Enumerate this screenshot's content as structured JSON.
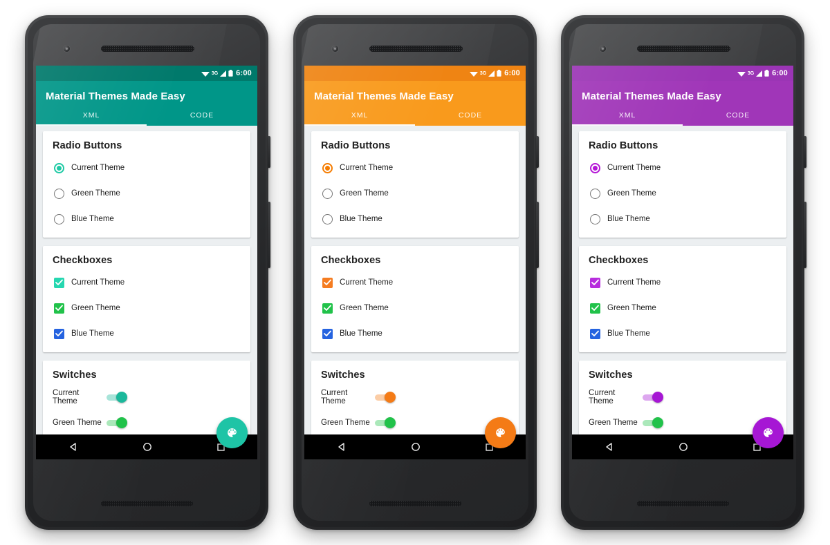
{
  "app": {
    "title": "Material Themes Made Easy",
    "tabs": [
      {
        "label": "XML",
        "selected": true
      },
      {
        "label": "CODE",
        "selected": false
      }
    ],
    "statusbar": {
      "time": "6:00",
      "network": "3G",
      "wifi_icon": "wifi-icon",
      "signal_icon": "signal-icon",
      "battery_icon": "battery-icon"
    },
    "fab": {
      "icon": "palette-icon"
    },
    "navbar": {
      "back": "back-triangle-icon",
      "home": "home-circle-icon",
      "recents": "recents-square-icon"
    }
  },
  "cards": {
    "radio": {
      "title": "Radio Buttons",
      "options": [
        "Current Theme",
        "Green Theme",
        "Blue Theme"
      ],
      "selected_index": 0
    },
    "checkbox": {
      "title": "Checkboxes",
      "options": [
        "Current Theme",
        "Green Theme",
        "Blue Theme"
      ]
    },
    "switch": {
      "title": "Switches",
      "options": [
        "Current Theme",
        "Green Theme"
      ]
    }
  },
  "themes": [
    {
      "name": "teal",
      "primary": "#009688",
      "primary_dark": "#00796b",
      "accent": "#1ec9a4",
      "checkbox_current": "#26d7b0",
      "switch_current": "#1bb89b",
      "fab": "#1ec4a6"
    },
    {
      "name": "orange",
      "primary": "#f99a1c",
      "primary_dark": "#ef8413",
      "accent": "#f57c00",
      "checkbox_current": "#f57c20",
      "switch_current": "#f47b16",
      "fab": "#f47b16"
    },
    {
      "name": "purple",
      "primary": "#a036b8",
      "primary_dark": "#9b35b5",
      "accent": "#b416d6",
      "checkbox_current": "#b72ddd",
      "switch_current": "#a617d4",
      "fab": "#a617d4"
    }
  ],
  "shared_colors": {
    "green": "#21c24a",
    "blue": "#2563e0",
    "radio_off_border": "#757575",
    "card_bg": "#ffffff",
    "screen_bg": "#eceff1",
    "navbar_bg": "#000000"
  }
}
